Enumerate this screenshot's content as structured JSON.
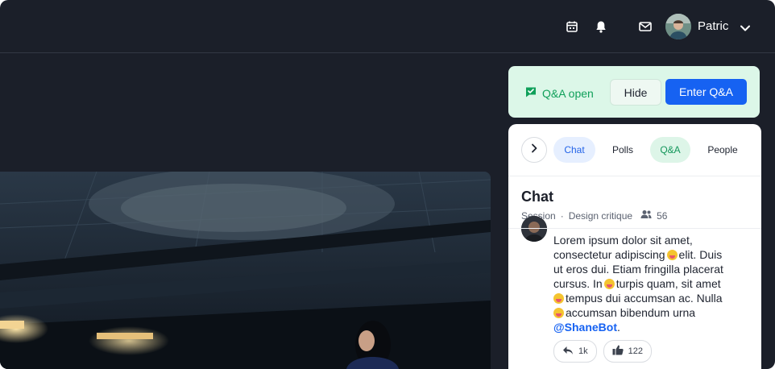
{
  "header": {
    "user_name": "Patric",
    "icons": [
      "calendar-icon",
      "bell-icon",
      "mail-icon",
      "chevron-down-icon"
    ]
  },
  "qa_bar": {
    "status_label": "Q&A open",
    "hide_label": "Hide",
    "enter_label": "Enter Q&A"
  },
  "tabs": [
    {
      "label": "Chat"
    },
    {
      "label": "Polls"
    },
    {
      "label": "Q&A"
    },
    {
      "label": "People"
    }
  ],
  "chat": {
    "title": "Chat",
    "meta": {
      "session": "Session",
      "separator": "·",
      "name": "Design critique",
      "participants": "56"
    },
    "message": {
      "lines": [
        "Lorem ipsum dolor sit amet,",
        "consectetur adipiscing",
        "elit. Duis",
        "ut eros dui. Etiam fringilla placerat",
        "cursus. In",
        "turpis quam, sit amet",
        "tempus dui accumsan ac. Nulla",
        "accumsan bibendum urna"
      ],
      "mention": "@ShaneBot",
      "mention_suffix": ".",
      "reactions": {
        "reply_count": "1k",
        "like_count": "122"
      }
    }
  },
  "colors": {
    "background": "#1b1f29",
    "accent": "#1662f2",
    "qa_green": "#10a05a"
  }
}
